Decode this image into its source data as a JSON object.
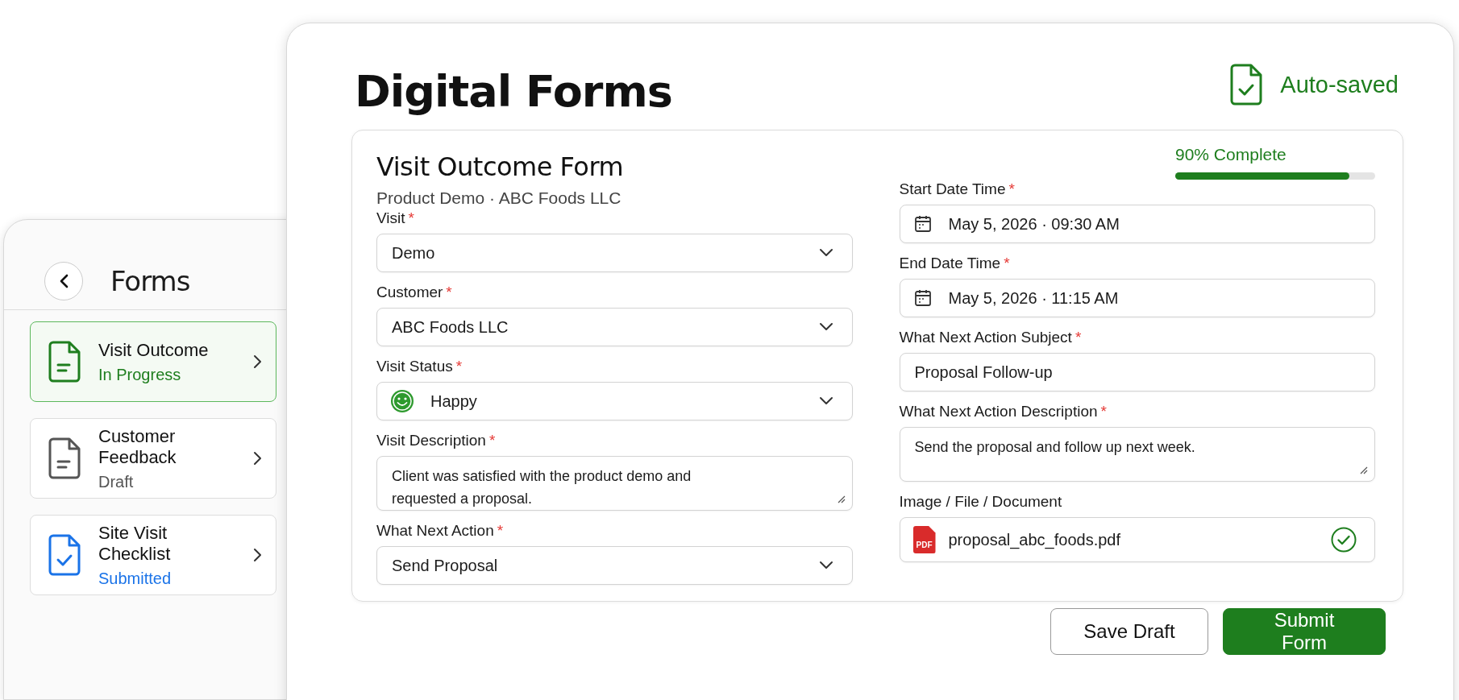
{
  "sidebar": {
    "title": "Forms",
    "items": [
      {
        "title": "Visit Outcome",
        "status": "In Progress",
        "color": "#1e7e1e",
        "kind": "lines",
        "selected": true
      },
      {
        "title": "Customer Feedback",
        "status": "Draft",
        "color": "#555555",
        "kind": "lines",
        "selected": false
      },
      {
        "title": "Site Visit Checklist",
        "status": "Submitted",
        "color": "#1a73e8",
        "kind": "check",
        "selected": false
      }
    ]
  },
  "header": {
    "title": "Digital Forms",
    "autosave": "Auto-saved"
  },
  "form": {
    "title": "Visit Outcome Form",
    "subtitle": "Product Demo · ABC Foods LLC",
    "progress": {
      "label": "90% Complete",
      "level": 0.87
    },
    "columns": [
      {
        "fields": [
          {
            "label": "Visit",
            "required_mark": "*",
            "kind": "select",
            "value": "Demo"
          },
          {
            "label": "Customer",
            "required_mark": "*",
            "kind": "select",
            "value": "ABC Foods LLC"
          },
          {
            "label": "Visit Status",
            "required_mark": "*",
            "kind": "status_select",
            "value": "Happy"
          },
          {
            "label": "Visit Description",
            "required_mark": "*",
            "kind": "textarea",
            "value": "Client was satisfied with the product demo and requested a proposal."
          },
          {
            "label": "What Next Action",
            "required_mark": "*",
            "kind": "select",
            "value": "Send Proposal"
          }
        ]
      },
      {
        "fields": [
          {
            "label": "Start Date Time",
            "required_mark": "*",
            "kind": "datetime",
            "value": "May 5, 2026 · 09:30 AM"
          },
          {
            "label": "End Date Time",
            "required_mark": "*",
            "kind": "datetime",
            "value": "May 5, 2026 · 11:15 AM"
          },
          {
            "label": "What Next Action Subject",
            "required_mark": "*",
            "kind": "text",
            "value": "Proposal Follow-up"
          },
          {
            "label": "What Next Action Description",
            "required_mark": "*",
            "kind": "textarea",
            "value": "Send the proposal and follow up next week."
          },
          {
            "label": "Image / File / Document",
            "kind": "file",
            "file_badge": "PDF",
            "value": "proposal_abc_foods.pdf",
            "uploaded": true
          }
        ]
      }
    ]
  },
  "buttons": [
    {
      "label": "Save Draft",
      "kind": "secondary"
    },
    {
      "label": "Submit Form",
      "kind": "primary"
    }
  ]
}
